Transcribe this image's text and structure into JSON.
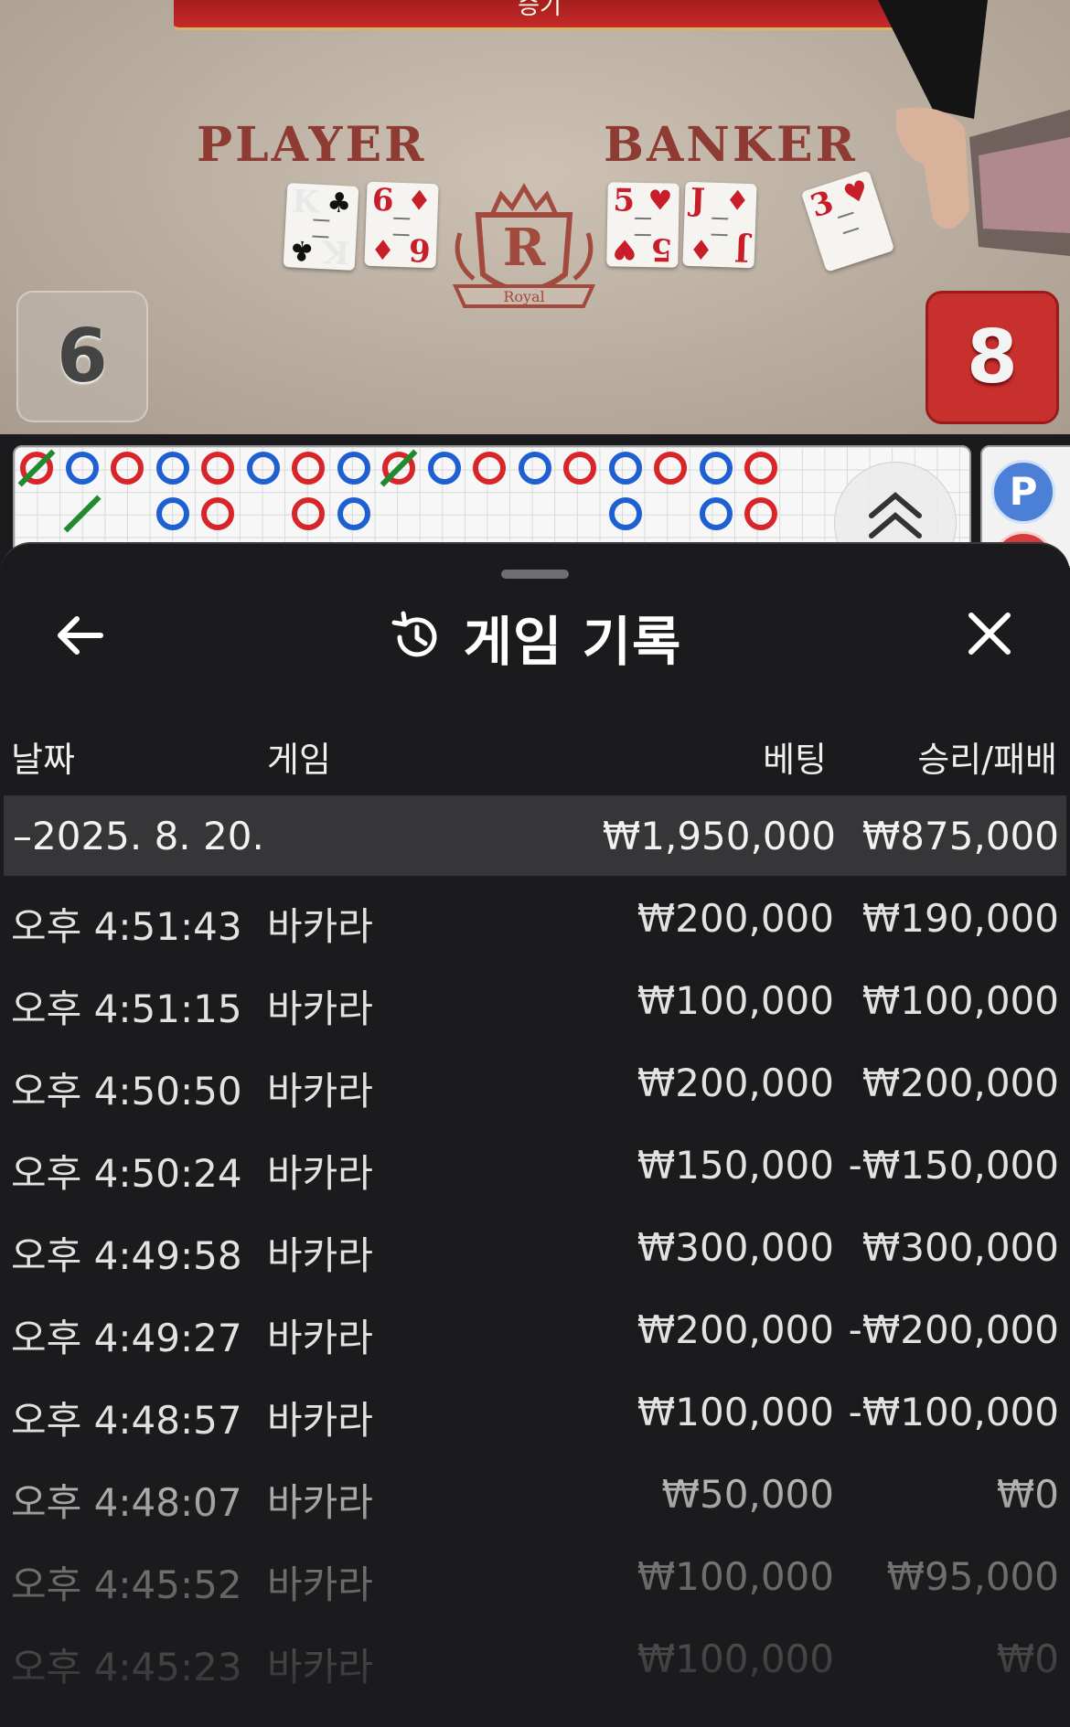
{
  "video": {
    "banner_text": "승기",
    "player_label": "PLAYER",
    "banker_label": "BANKER",
    "player_score": "6",
    "banker_score": "8",
    "player_cards": [
      {
        "rank": "K",
        "suit": "♣",
        "color": "black"
      },
      {
        "rank": "6",
        "suit": "♦",
        "color": "red"
      }
    ],
    "banker_cards": [
      {
        "rank": "5",
        "suit": "♥",
        "color": "red"
      },
      {
        "rank": "J",
        "suit": "♦",
        "color": "red"
      }
    ],
    "third_card": {
      "rank": "3",
      "suit": "♥",
      "color": "red"
    },
    "logo_letter": "R",
    "logo_ribbon": "Royal"
  },
  "roadmap": {
    "player_badge": "P",
    "bead_colors": {
      "banker": "#d8252a",
      "player": "#1e5fd1",
      "tie": "#1f8a2e"
    }
  },
  "sheet": {
    "title": "게임 기록",
    "columns": {
      "date": "날짜",
      "game": "게임",
      "bet": "베팅",
      "result": "승리/패배"
    },
    "date_group": {
      "date": "–2025. 8. 20.",
      "bet_total": "₩1,950,000",
      "result_total": "₩875,000"
    },
    "rows": [
      {
        "time": "오후 4:51:43",
        "game": "바카라",
        "bet": "₩200,000",
        "result": "₩190,000"
      },
      {
        "time": "오후 4:51:15",
        "game": "바카라",
        "bet": "₩100,000",
        "result": "₩100,000"
      },
      {
        "time": "오후 4:50:50",
        "game": "바카라",
        "bet": "₩200,000",
        "result": "₩200,000"
      },
      {
        "time": "오후 4:50:24",
        "game": "바카라",
        "bet": "₩150,000",
        "result": "-₩150,000"
      },
      {
        "time": "오후 4:49:58",
        "game": "바카라",
        "bet": "₩300,000",
        "result": "₩300,000"
      },
      {
        "time": "오후 4:49:27",
        "game": "바카라",
        "bet": "₩200,000",
        "result": "-₩200,000"
      },
      {
        "time": "오후 4:48:57",
        "game": "바카라",
        "bet": "₩100,000",
        "result": "-₩100,000"
      },
      {
        "time": "오후 4:48:07",
        "game": "바카라",
        "bet": "₩50,000",
        "result": "₩0"
      },
      {
        "time": "오후 4:45:52",
        "game": "바카라",
        "bet": "₩100,000",
        "result": "₩95,000"
      },
      {
        "time": "오후 4:45:23",
        "game": "바카라",
        "bet": "₩100,000",
        "result": "₩0"
      }
    ]
  },
  "icons": {
    "back": "arrow-left-icon",
    "close": "close-icon",
    "history": "history-icon",
    "expand": "chevron-double-up-icon"
  }
}
